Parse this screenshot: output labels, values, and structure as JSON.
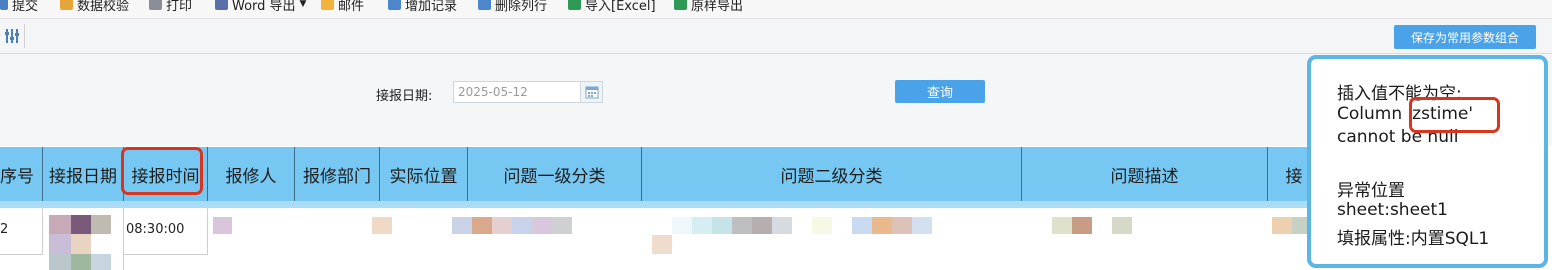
{
  "toolbar": {
    "submit": "提交",
    "validate": "数据校验",
    "print": "打印",
    "word_export": "Word 导出",
    "mail": "邮件",
    "add_record": "增加记录",
    "delete_row": "删除列行",
    "import_excel": "导入[Excel]",
    "export_original": "原样导出"
  },
  "subbar": {
    "save_label": "保存为常用参数组合"
  },
  "form": {
    "date_label": "接报日期:",
    "date_value": "2025-05-12",
    "query_label": "查询"
  },
  "table": {
    "headers": [
      "序号",
      "接报日期",
      "接报时间",
      "报修人",
      "报修部门",
      "实际位置",
      "问题一级分类",
      "问题二级分类",
      "问题描述",
      "接"
    ],
    "rows": [
      {
        "seq": "2",
        "time": "08:30:00"
      }
    ]
  },
  "popup": {
    "line1": "插入值不能为空:",
    "line2": "Column 'zstime'",
    "line3": "cannot be null",
    "line4": "异常位置",
    "line5": "sheet:sheet1",
    "line6": "填报属性:内置SQL1"
  },
  "colors": {
    "header_bg": "#76c8f3",
    "button_bg": "#4aa3e8",
    "highlight": "#d8341e",
    "popup_border": "#5bb6e6"
  }
}
